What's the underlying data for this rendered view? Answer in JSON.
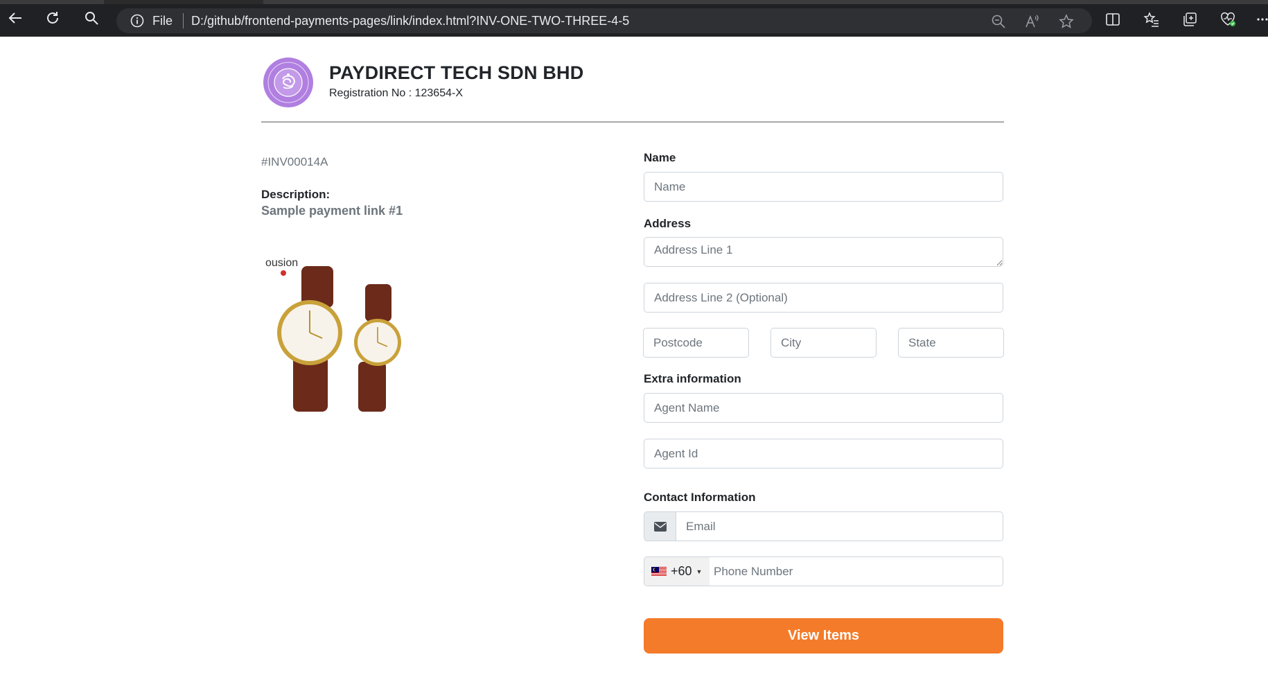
{
  "browser": {
    "scheme_label": "File",
    "url": "D:/github/frontend-payments-pages/link/index.html?INV-ONE-TWO-THREE-4-5",
    "icons": [
      "back-icon",
      "refresh-icon",
      "search-icon",
      "info-icon",
      "zoom-out-icon",
      "read-aloud-icon",
      "favorite-star-icon",
      "split-screen-icon",
      "favorites-icon",
      "collections-icon",
      "browser-essentials-icon",
      "more-icon"
    ]
  },
  "merchant": {
    "name": "PAYDIRECT TECH SDN BHD",
    "registration": "Registration No : 123654-X",
    "logo_color": "#b07fe0"
  },
  "invoice": {
    "number": "#INV00014A",
    "description_label": "Description:",
    "description": "Sample payment link #1",
    "product_brand": "ousion"
  },
  "form": {
    "name_label": "Name",
    "name_placeholder": "Name",
    "address_label": "Address",
    "address1_placeholder": "Address Line 1",
    "address2_placeholder": "Address Line 2 (Optional)",
    "postcode_placeholder": "Postcode",
    "city_placeholder": "City",
    "state_placeholder": "State",
    "extra_label": "Extra information",
    "agent_name_placeholder": "Agent Name",
    "agent_id_placeholder": "Agent Id",
    "contact_label": "Contact Information",
    "email_placeholder": "Email",
    "dial_code": "+60",
    "phone_placeholder": "Phone Number",
    "submit_label": "View Items"
  },
  "colors": {
    "accent": "#f47b2a",
    "muted_text": "#6c757d",
    "chrome_bg": "#202124"
  }
}
